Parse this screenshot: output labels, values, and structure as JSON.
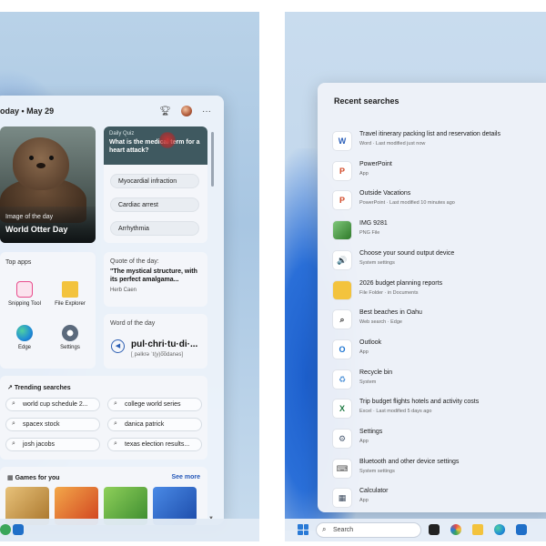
{
  "widgets": {
    "date": "oday • May 29",
    "image_of_day": {
      "label": "Image of the day",
      "title": "World Otter Day"
    },
    "quiz": {
      "label": "Daily Quiz",
      "question": "What is the medical term for a heart attack?",
      "options": [
        "Myocardial infraction",
        "Cardiac arrest",
        "Arrhythmia"
      ]
    },
    "top_apps": {
      "title": "Top apps",
      "apps": [
        {
          "label": "Snipping Tool",
          "icon": "snipping-tool-icon",
          "color": "#e84c8c"
        },
        {
          "label": "File Explorer",
          "icon": "folder-icon",
          "color": "#f3c33d"
        },
        {
          "label": "Edge",
          "icon": "edge-icon",
          "color": "#1f8dd6"
        },
        {
          "label": "Settings",
          "icon": "gear-icon",
          "color": "#5b6a7c"
        }
      ]
    },
    "quote": {
      "label": "Quote of the day:",
      "text": "\"The mystical structure, with its perfect amalgama...",
      "author": "Herb Caen"
    },
    "word": {
      "label": "Word of the day",
      "word": "pul·chri·tu·di·...",
      "phonetic": "[ˌpəlkrə ˈt(y)o͞odanəs]"
    },
    "trending": {
      "title": "Trending searches",
      "items": [
        "world cup schedule 2...",
        "college world series",
        "spacex stock",
        "danica patrick",
        "josh jacobs",
        "texas election results..."
      ]
    },
    "games": {
      "title": "Games for you",
      "see_more": "See more",
      "tiles": [
        {
          "name": "game-tile-1",
          "color": "#d8a24a"
        },
        {
          "name": "game-tile-2",
          "color": "#e65b2c"
        },
        {
          "name": "game-tile-3",
          "color": "#4a9d3a"
        },
        {
          "name": "game-tile-4",
          "color": "#2867c9"
        }
      ]
    }
  },
  "search": {
    "title": "Recent searches",
    "results": [
      {
        "name": "Travel itinerary packing list and reservation details",
        "sub": "Word · Last modified just now",
        "icon": "word-icon",
        "glyph": "W",
        "color": "#2b5fb9"
      },
      {
        "name": "PowerPoint",
        "sub": "App",
        "icon": "powerpoint-icon",
        "glyph": "P",
        "color": "#d24726"
      },
      {
        "name": "Outside Vacations",
        "sub": "PowerPoint · Last modified 10 minutes ago",
        "icon": "powerpoint-file-icon",
        "glyph": "P",
        "color": "#d24726"
      },
      {
        "name": "IMG 9281",
        "sub": "PNG File",
        "icon": "image-icon",
        "glyph": "",
        "color": "#3f8f3a"
      },
      {
        "name": "Choose your sound output device",
        "sub": "System settings",
        "icon": "speaker-icon",
        "glyph": "🔊",
        "color": "#555555"
      },
      {
        "name": "2026 budget planning reports",
        "sub": "File Folder · in Documents",
        "icon": "folder-icon",
        "glyph": "",
        "color": "#f3c33d"
      },
      {
        "name": "Best beaches in Oahu",
        "sub": "Web search · Edge",
        "icon": "search-icon",
        "glyph": "⌕",
        "color": "#333333"
      },
      {
        "name": "Outlook",
        "sub": "App",
        "icon": "outlook-icon",
        "glyph": "O",
        "color": "#1a73d1"
      },
      {
        "name": "Recycle bin",
        "sub": "System",
        "icon": "recycle-bin-icon",
        "glyph": "♻",
        "color": "#4a8fd6"
      },
      {
        "name": "Trip budget flights hotels and activity costs",
        "sub": "Excel · Last modified 5 days ago",
        "icon": "excel-icon",
        "glyph": "X",
        "color": "#1f7a43"
      },
      {
        "name": "Settings",
        "sub": "App",
        "icon": "gear-icon",
        "glyph": "⚙",
        "color": "#4b5b72"
      },
      {
        "name": "Bluetooth and other device settings",
        "sub": "System settings",
        "icon": "bluetooth-icon",
        "glyph": "⌨",
        "color": "#555555"
      },
      {
        "name": "Calculator",
        "sub": "App",
        "icon": "calculator-icon",
        "glyph": "▦",
        "color": "#3c4a5e"
      }
    ]
  },
  "taskbar": {
    "search_placeholder": "Search"
  }
}
